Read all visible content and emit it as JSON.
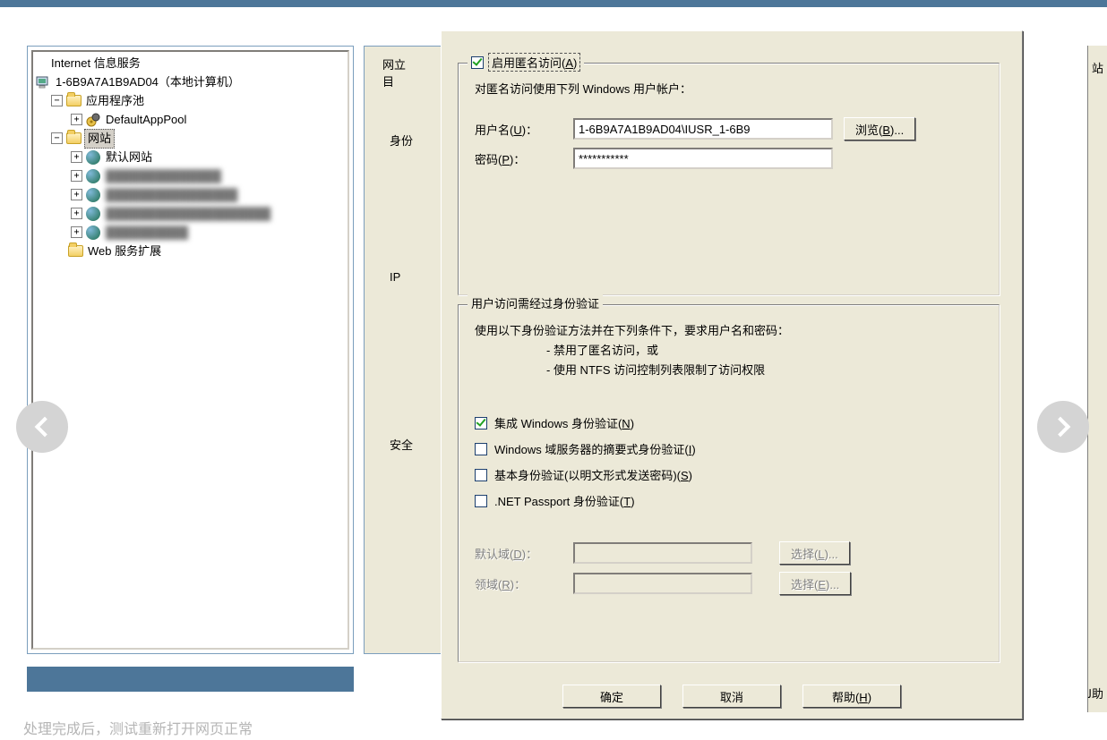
{
  "tree": {
    "root": "Internet 信息服务",
    "computer": "1-6B9A7A1B9AD04（本地计算机）",
    "app_pool": "应用程序池",
    "default_pool": "DefaultAppPool",
    "websites": "网站",
    "default_site": "默认网站",
    "web_ext": "Web 服务扩展"
  },
  "bg": {
    "tab1": "网立",
    "tab1b": "目",
    "group1": "身份",
    "group2": "IP",
    "group3": "安全",
    "peek1": "站",
    "peek2": "ﻟ助"
  },
  "dialog": {
    "anon_group": {
      "checkbox_label": "启用匿名访问(A)",
      "desc": "对匿名访问使用下列 Windows 用户帐户：",
      "username_label": "用户名(U)：",
      "username_value": "1-6B9A7A1B9AD04\\IUSR_1-6B9",
      "browse_btn": "浏览(B)...",
      "password_label": "密码(P)：",
      "password_value": "***********"
    },
    "auth_group": {
      "title": "用户访问需经过身份验证",
      "desc": "使用以下身份验证方法并在下列条件下，要求用户名和密码：",
      "bullet1": "- 禁用了匿名访问，或",
      "bullet2": "- 使用 NTFS 访问控制列表限制了访问权限",
      "integrated": "集成 Windows 身份验证(N)",
      "digest": "Windows 域服务器的摘要式身份验证(I)",
      "basic": "基本身份验证(以明文形式发送密码)(S)",
      "passport": ".NET Passport 身份验证(T)",
      "default_domain": "默认域(D)：",
      "realm": "领域(R)：",
      "select1": "选择(L)...",
      "select2": "选择(E)..."
    },
    "buttons": {
      "ok": "确定",
      "cancel": "取消",
      "help": "帮助(H)"
    }
  },
  "footer": "处理完成后，测试重新打开网页正常"
}
